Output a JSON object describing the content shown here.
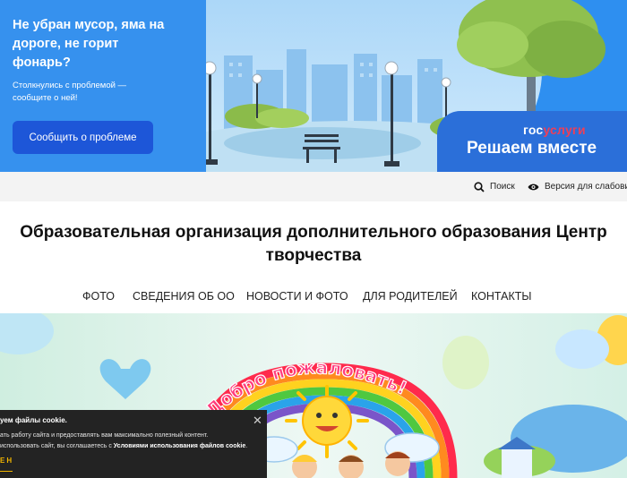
{
  "banner": {
    "title": "Не убран мусор, яма на дороге, не горит фонарь?",
    "subtitle": "Столкнулись с проблемой — сообщите о ней!",
    "report_button": "Сообщить о проблеме",
    "brand_part1": "гос",
    "brand_part2": "услуги",
    "slogan": "Решаем вместе"
  },
  "utility": {
    "search_label": "Поиск",
    "accessibility_label": "Версия для слабовидящих"
  },
  "page": {
    "title_line1": "Образовательная организация дополнительного образования Центр",
    "title_line2": "творчества"
  },
  "nav": {
    "items": [
      "ФОТО",
      "СВЕДЕНИЯ ОБ ОО",
      "НОВОСТИ И ФОТО",
      "ДЛЯ РОДИТЕЛЕЙ",
      "КОНТАКТЫ"
    ]
  },
  "hero": {
    "welcome_text": "Добро пожаловать!"
  },
  "cookie": {
    "title": "уем файлы cookie.",
    "text_line1": "ать работу сайта и предоставлять вам максимально полезный контент.",
    "text_line2_prefix": "использовать сайт, вы соглашаетесь с ",
    "text_link": "Условиями использования файлов cookie",
    "text_line2_suffix": ".",
    "accept": "ЕН",
    "close": "✕"
  },
  "colors": {
    "banner_blue": "#3691ee",
    "button_blue": "#1d56d8",
    "brand_red": "#ee3f58",
    "cookie_bg": "#232323",
    "cookie_accent": "#f0b400"
  }
}
